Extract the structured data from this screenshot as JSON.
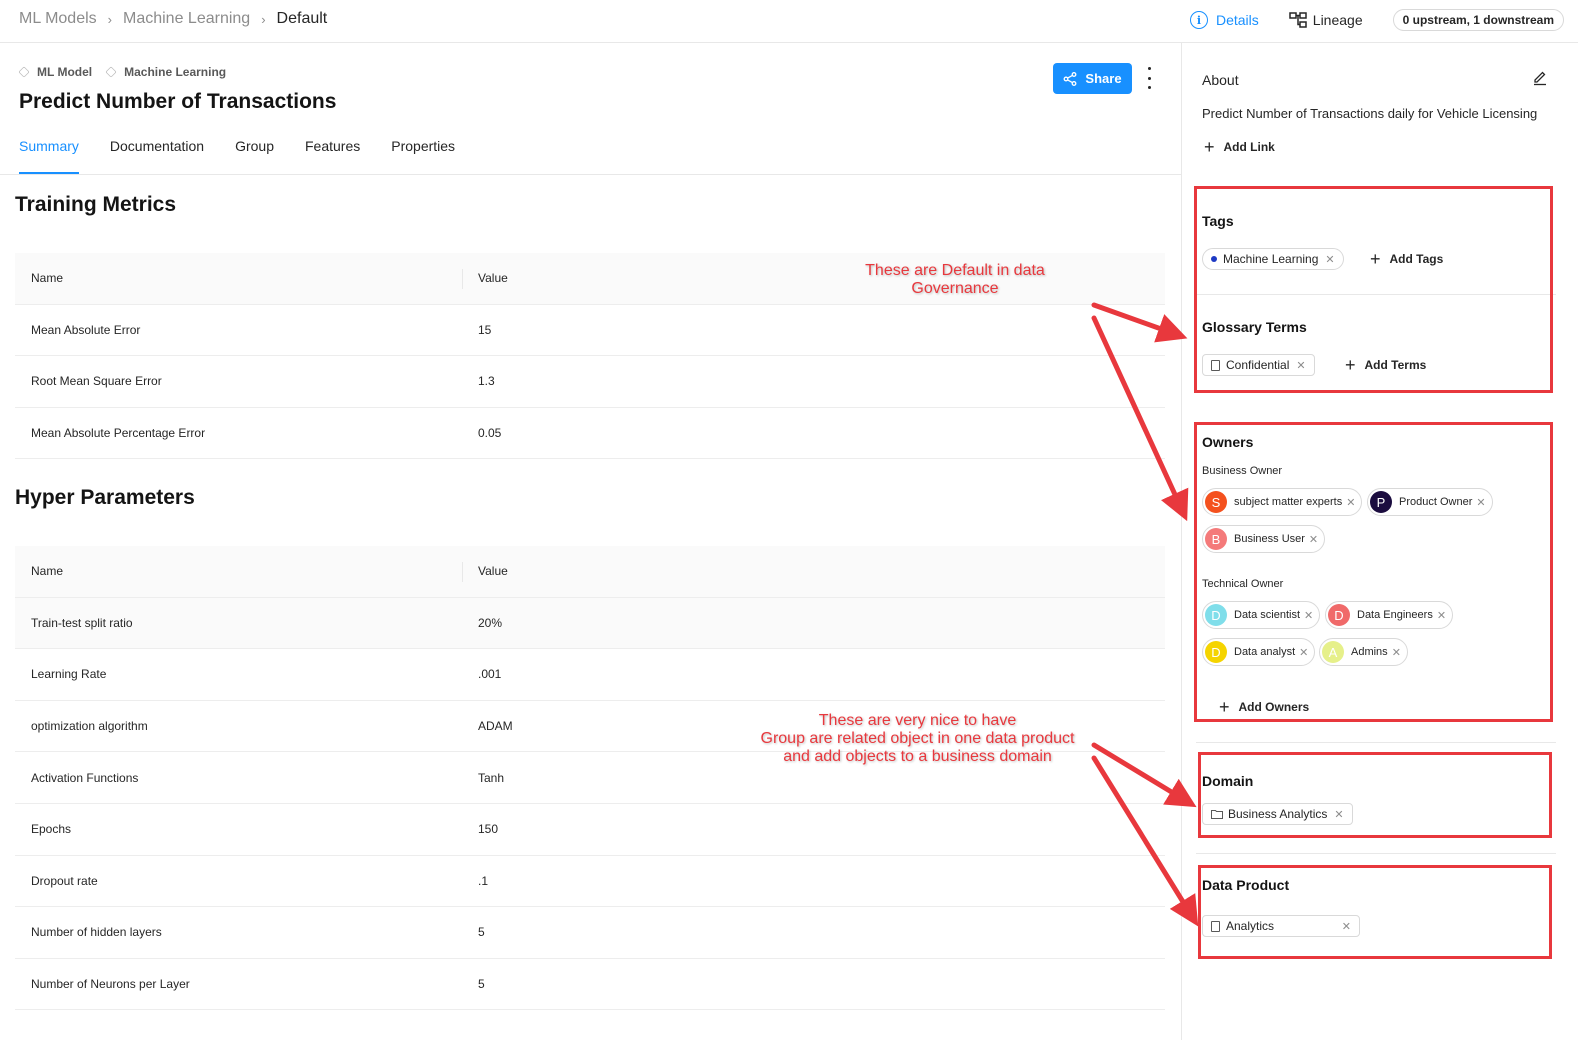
{
  "breadcrumb": {
    "items": [
      "ML Models",
      "Machine Learning"
    ],
    "current": "Default",
    "separator": "›"
  },
  "view_tabs": {
    "details": "Details",
    "lineage": "Lineage",
    "lineage_count": "0 upstream, 1 downstream"
  },
  "entity": {
    "type": "ML Model",
    "group": "Machine Learning",
    "title": "Predict Number of Transactions",
    "share_label": "Share"
  },
  "tabs": [
    "Summary",
    "Documentation",
    "Group",
    "Features",
    "Properties"
  ],
  "active_tab": "Summary",
  "training_metrics": {
    "title": "Training Metrics",
    "headers": [
      "Name",
      "Value"
    ],
    "rows": [
      [
        "Mean Absolute Error",
        "15"
      ],
      [
        "Root Mean Square Error",
        "1.3"
      ],
      [
        "Mean Absolute Percentage Error",
        "0.05"
      ]
    ]
  },
  "hyper_parameters": {
    "title": "Hyper Parameters",
    "headers": [
      "Name",
      "Value"
    ],
    "rows": [
      [
        "Train-test split ratio",
        "20%"
      ],
      [
        "Learning Rate",
        ".001"
      ],
      [
        "optimization algorithm",
        "ADAM"
      ],
      [
        "Activation Functions",
        "Tanh"
      ],
      [
        "Epochs",
        "150"
      ],
      [
        "Dropout rate",
        ".1"
      ],
      [
        "Number of hidden layers",
        "5"
      ],
      [
        "Number of Neurons per Layer",
        "5"
      ]
    ]
  },
  "sidebar": {
    "about": {
      "title": "About",
      "text": "Predict Number of Transactions daily for Vehicle Licensing",
      "add_link": "Add Link"
    },
    "tags": {
      "title": "Tags",
      "items": [
        "Machine Learning"
      ],
      "add_label": "Add Tags"
    },
    "glossary": {
      "title": "Glossary Terms",
      "items": [
        "Confidential"
      ],
      "add_label": "Add Terms"
    },
    "owners": {
      "title": "Owners",
      "business_label": "Business Owner",
      "business": [
        {
          "initial": "S",
          "name": "subject matter experts",
          "color": "#f4511e"
        },
        {
          "initial": "P",
          "name": "Product Owner",
          "color": "#1b0c3f"
        },
        {
          "initial": "B",
          "name": "Business User",
          "color": "#f47a7a"
        }
      ],
      "technical_label": "Technical Owner",
      "technical": [
        {
          "initial": "D",
          "name": "Data scientist",
          "color": "#80deea"
        },
        {
          "initial": "D",
          "name": "Data Engineers",
          "color": "#f06a6a"
        },
        {
          "initial": "D",
          "name": "Data analyst",
          "color": "#f5d400"
        },
        {
          "initial": "A",
          "name": "Admins",
          "color": "#e6f08a"
        }
      ],
      "add_label": "Add Owners"
    },
    "domain": {
      "title": "Domain",
      "items": [
        "Business Analytics"
      ]
    },
    "data_product": {
      "title": "Data Product",
      "items": [
        "Analytics"
      ]
    }
  },
  "annotations": {
    "governance_line1": "These are Default in data",
    "governance_line2": "Governance",
    "nice_line1": "These are very nice to have",
    "nice_line2": "Group are related object in one data product",
    "nice_line3": "and add objects to a business domain"
  },
  "colors": {
    "accent": "#1890ff",
    "annotation": "#e8383d"
  }
}
